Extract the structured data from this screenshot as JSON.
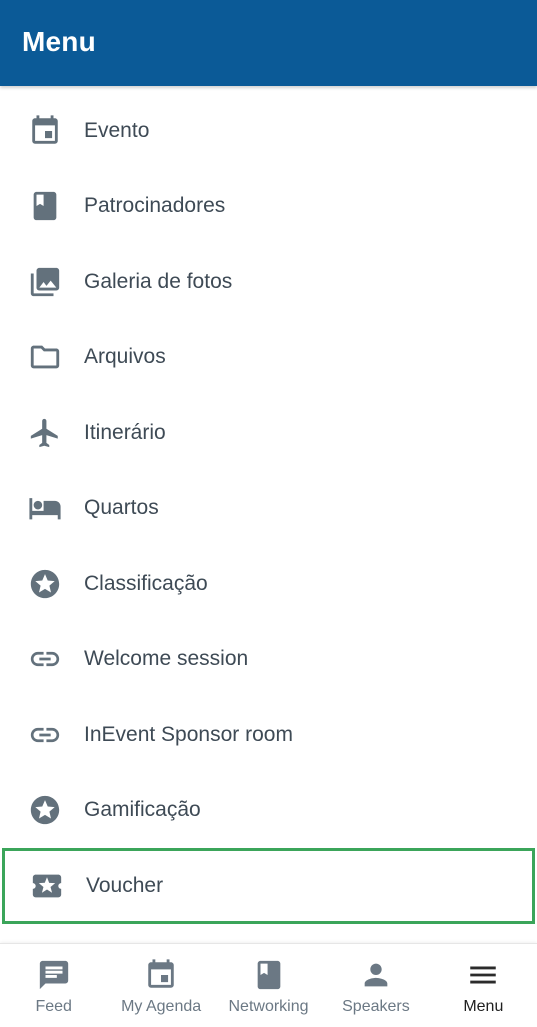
{
  "header": {
    "title": "Menu"
  },
  "menu": {
    "items": [
      {
        "label": "Evento",
        "icon": "calendar-icon"
      },
      {
        "label": "Patrocinadores",
        "icon": "book-icon"
      },
      {
        "label": "Galeria de fotos",
        "icon": "photo-library-icon"
      },
      {
        "label": "Arquivos",
        "icon": "folder-icon"
      },
      {
        "label": "Itinerário",
        "icon": "airplane-icon"
      },
      {
        "label": "Quartos",
        "icon": "bed-icon"
      },
      {
        "label": "Classificação",
        "icon": "star-circle-icon"
      },
      {
        "label": "Welcome session",
        "icon": "link-icon"
      },
      {
        "label": "InEvent Sponsor room",
        "icon": "link-icon"
      },
      {
        "label": "Gamificação",
        "icon": "star-circle-icon"
      },
      {
        "label": "Voucher",
        "icon": "ticket-icon",
        "highlighted": true
      }
    ]
  },
  "bottom_nav": {
    "items": [
      {
        "label": "Feed",
        "icon": "feed-icon"
      },
      {
        "label": "My Agenda",
        "icon": "calendar-icon"
      },
      {
        "label": "Networking",
        "icon": "book-icon"
      },
      {
        "label": "Speakers",
        "icon": "person-icon"
      },
      {
        "label": "Menu",
        "icon": "hamburger-icon",
        "active": true
      }
    ]
  },
  "colors": {
    "app_bar": "#0b5a97",
    "icon": "#63717c",
    "highlight_border": "#3ba55a"
  }
}
